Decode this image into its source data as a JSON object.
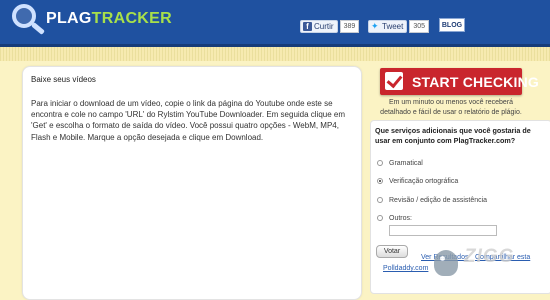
{
  "header": {
    "logo_plag": "PLAG",
    "logo_tracker": "TRACKER",
    "facebook": {
      "label": "Curtir",
      "count": "389"
    },
    "twitter": {
      "label": "Tweet",
      "count": "305"
    },
    "blog_label": "BLOG"
  },
  "panel": {
    "title": "Baixe seus vídeos",
    "body": "Para iniciar o download de um vídeo, copie o link da página do Youtube onde este se encontra e cole no campo 'URL' do Rylstim YouTube Downloader. Em seguida clique em 'Get' e escolha o formato de saída do vídeo. Você possui quatro opções - WebM, MP4, Flash e Mobile. Marque a opção desejada e clique em Download."
  },
  "sidebar": {
    "cta_label": "START CHECKING",
    "cta_sub": "Em um minuto ou menos você receberá detalhado e fácil de usar o relatório de plágio.",
    "survey": {
      "question": "Que serviços adicionais que você gostaria de usar em conjunto com PlagTracker.com?",
      "options": [
        {
          "label": "Gramatical",
          "selected": false
        },
        {
          "label": "Verificação ortográfica",
          "selected": true
        },
        {
          "label": "Revisão / edição de assistência",
          "selected": false
        },
        {
          "label": "Outros:",
          "selected": false
        }
      ],
      "vote_label": "Votar",
      "results_link": "Ver Resultados",
      "share_link": "Compartilhar esta",
      "credit_link": "Polldaddy.com"
    }
  },
  "watermark": "ZIGG"
}
